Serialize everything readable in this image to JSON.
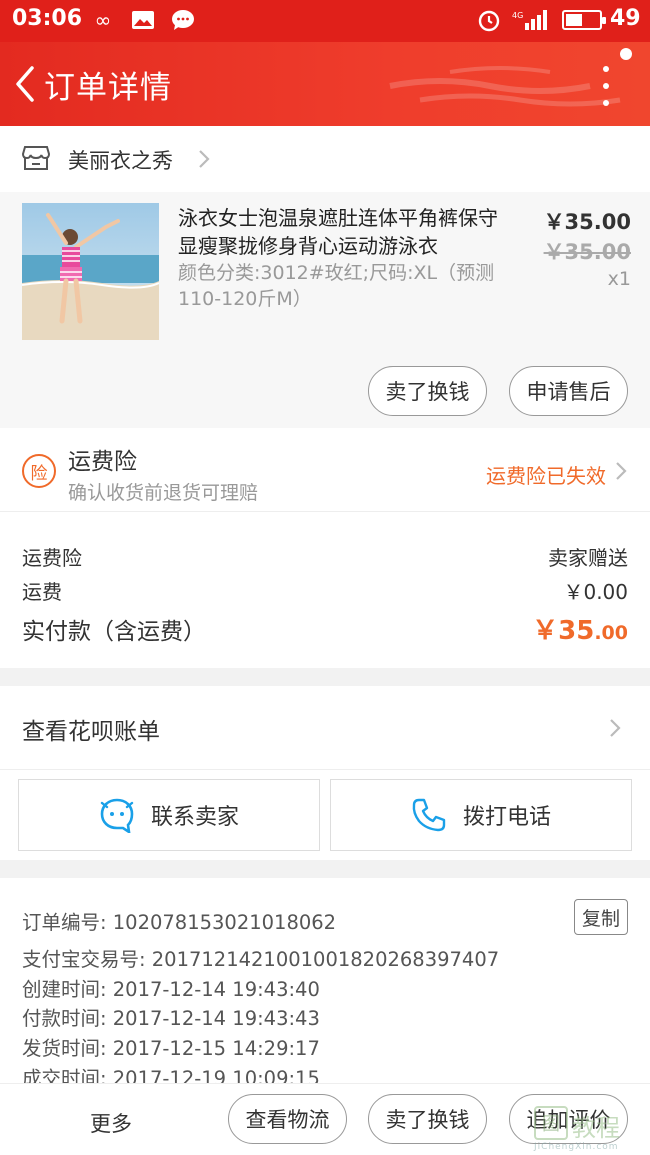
{
  "status_bar": {
    "time": "03:06",
    "network": "4G",
    "battery": "49",
    "battery_level": 0.49
  },
  "header": {
    "title": "订单详情"
  },
  "shop": {
    "name": "美丽衣之秀"
  },
  "product": {
    "title": "泳衣女士泡温泉遮肚连体平角裤保守显瘦聚拢修身背心运动游泳衣",
    "sku": "颜色分类:3012#玫红;尺码:XL（预测110-120斤M）",
    "price": "￥35.00",
    "original_price": "￥35.00",
    "quantity": "x1",
    "actions": {
      "sell_label": "卖了换钱",
      "aftersale_label": "申请售后"
    }
  },
  "insurance": {
    "badge": "险",
    "title": "运费险",
    "subtitle": "确认收货前退货可理赔",
    "status": "运费险已失效",
    "status_color": "#f06a2a"
  },
  "costs": {
    "insurance_label": "运费险",
    "insurance_value": "卖家赠送",
    "shipping_label": "运费",
    "shipping_value": "￥0.00",
    "total_label": "实付款（含运费）",
    "total_integer": "￥35",
    "total_decimal": ".00"
  },
  "huabei": {
    "label": "查看花呗账单"
  },
  "contact": {
    "seller_label": "联系卖家",
    "phone_label": "拨打电话",
    "icon_color": "#1aa0e8"
  },
  "order_info": {
    "order_no": "订单编号: 102078153021018062",
    "copy_label": "复制",
    "alipay_no": "支付宝交易号: 2017121421001001820268397407",
    "created": "创建时间: 2017-12-14 19:43:40",
    "paid": "付款时间: 2017-12-14 19:43:43",
    "shipped": "发货时间: 2017-12-15 14:29:17",
    "completed": "成交时间: 2017-12-19 10:09:15"
  },
  "bottom_bar": {
    "more_label": "更多",
    "logistics_label": "查看物流",
    "sell_label": "卖了换钱",
    "review_label": "追加评价"
  },
  "watermark": {
    "mark": "图",
    "text": "教程",
    "url": "JiChengXin.com"
  },
  "colors": {
    "primary_red": "#e0201a",
    "accent_orange": "#f06a2a"
  }
}
